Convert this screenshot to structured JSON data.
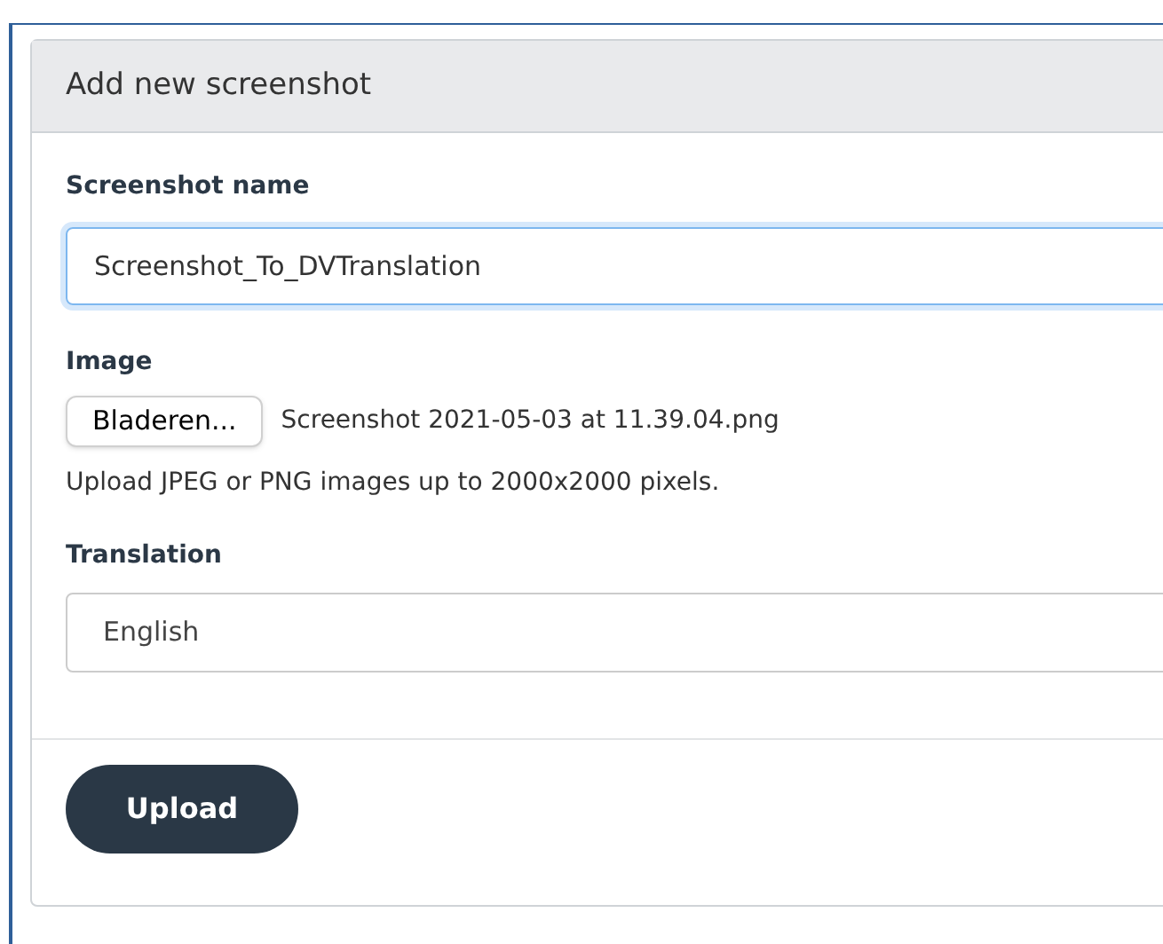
{
  "panel": {
    "title": "Add new screenshot"
  },
  "name_field": {
    "label": "Screenshot name",
    "value": "Screenshot_To_DVTranslation",
    "focused": true
  },
  "image_field": {
    "label": "Image",
    "browse_button": "Bladeren...",
    "file_name": "Screenshot 2021-05-03 at 11.39.04.png",
    "help": "Upload JPEG or PNG images up to 2000x2000 pixels."
  },
  "translation_field": {
    "label": "Translation",
    "value": "English"
  },
  "submit_button": "Upload"
}
